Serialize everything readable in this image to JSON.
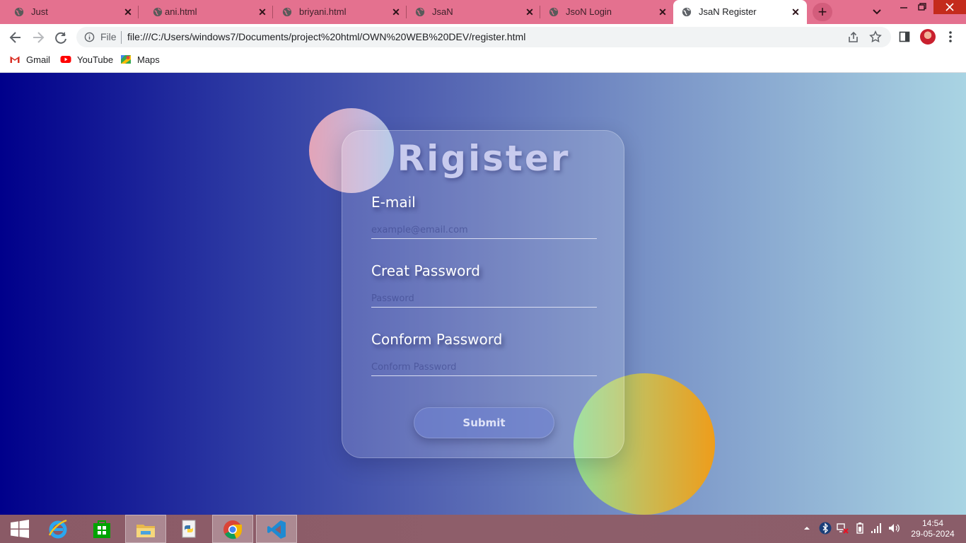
{
  "browser": {
    "tabs": [
      {
        "label": "Just",
        "icon": "globe-icon"
      },
      {
        "label": "ani.html",
        "icon": "globe-icon"
      },
      {
        "label": "briyani.html",
        "icon": "globe-icon"
      },
      {
        "label": "JsaN",
        "icon": "globe-icon"
      },
      {
        "label": "JsoN Login",
        "icon": "globe-icon"
      },
      {
        "label": "JsaN Register",
        "icon": "globe-icon",
        "active": true
      }
    ],
    "tab_close_glyph": "✕",
    "new_tab_glyph": "+",
    "address": {
      "scheme_label": "File",
      "url": "file:///C:/Users/windows7/Documents/project%20html/OWN%20WEB%20DEV/register.html"
    },
    "bookmarks": [
      {
        "label": "Gmail",
        "icon": "gmail-icon"
      },
      {
        "label": "YouTube",
        "icon": "youtube-icon"
      },
      {
        "label": "Maps",
        "icon": "maps-icon"
      }
    ],
    "colors": {
      "tabstrip": "#e4718f",
      "close_button": "#c42b1c"
    }
  },
  "page": {
    "title": "Rigister",
    "fields": [
      {
        "label": "E-mail",
        "placeholder": "example@email.com",
        "value": ""
      },
      {
        "label": "Creat Password",
        "placeholder": "Password",
        "value": ""
      },
      {
        "label": "Conform Password",
        "placeholder": "Conform Password",
        "value": ""
      }
    ],
    "submit_label": "Submit",
    "colors": {
      "gradient_start": "#00008b",
      "gradient_end": "#a9d4e3",
      "circle_pink": "#e3a4b8",
      "circle_orange": "#ee9d1b",
      "circle_green": "#90dc94"
    }
  },
  "taskbar": {
    "apps": [
      "start-icon",
      "internet-explorer-icon",
      "store-icon",
      "file-explorer-icon",
      "python-idle-icon",
      "chrome-icon",
      "vscode-icon"
    ],
    "tray": [
      "show-hidden-icons-icon",
      "bluetooth-icon",
      "network-error-icon",
      "battery-icon",
      "signal-icon",
      "volume-icon"
    ],
    "time": "14:54",
    "date": "29-05-2024"
  }
}
